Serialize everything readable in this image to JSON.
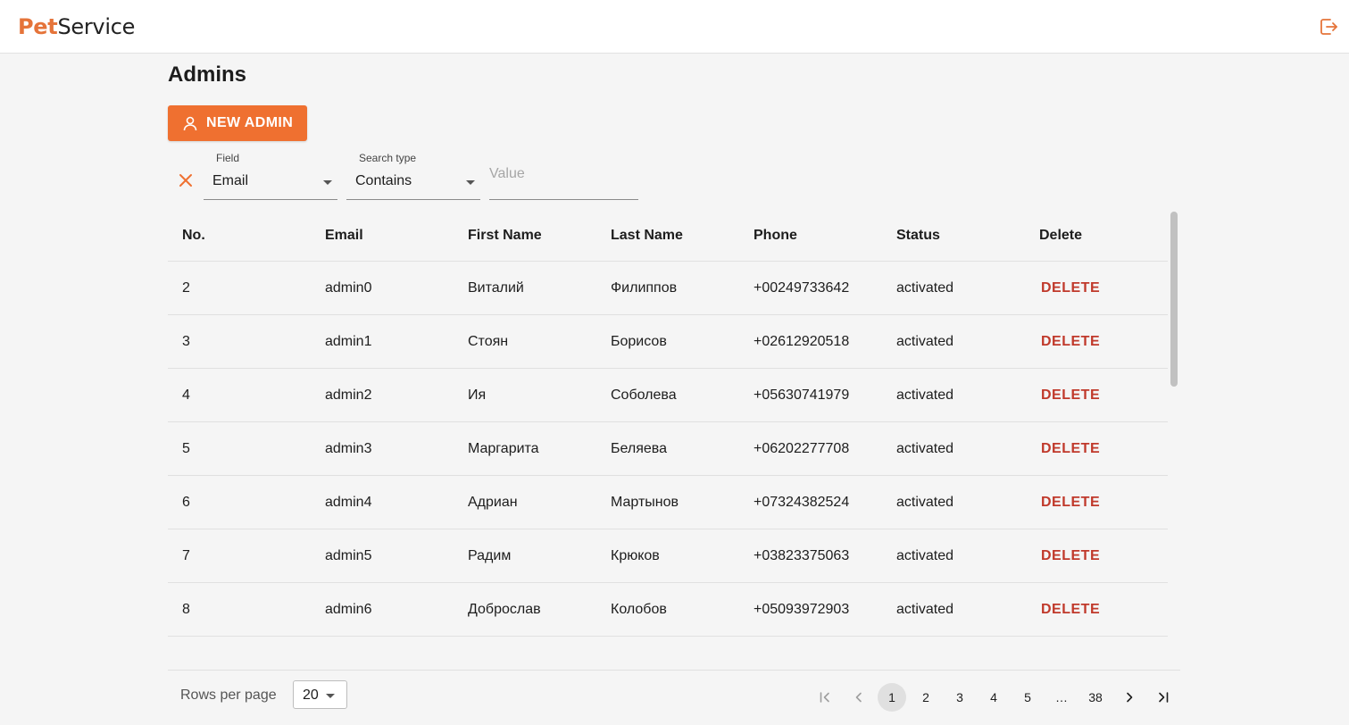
{
  "app": {
    "logo_pet": "Pet",
    "logo_service": "Service"
  },
  "page": {
    "title": "Admins"
  },
  "toolbar": {
    "new_admin_label": "NEW ADMIN"
  },
  "filter": {
    "field_caption": "Field",
    "field_value": "Email",
    "search_type_caption": "Search type",
    "search_type_value": "Contains",
    "value_placeholder": "Value"
  },
  "table": {
    "columns": [
      "No.",
      "Email",
      "First Name",
      "Last Name",
      "Phone",
      "Status",
      "Delete"
    ],
    "delete_label": "DELETE",
    "rows": [
      {
        "no": "2",
        "email": "admin0",
        "first": "Виталий",
        "last": "Филиппов",
        "phone": "+00249733642",
        "status": "activated"
      },
      {
        "no": "3",
        "email": "admin1",
        "first": "Стоян",
        "last": "Борисов",
        "phone": "+02612920518",
        "status": "activated"
      },
      {
        "no": "4",
        "email": "admin2",
        "first": "Ия",
        "last": "Соболева",
        "phone": "+05630741979",
        "status": "activated"
      },
      {
        "no": "5",
        "email": "admin3",
        "first": "Маргарита",
        "last": "Беляева",
        "phone": "+06202277708",
        "status": "activated"
      },
      {
        "no": "6",
        "email": "admin4",
        "first": "Адриан",
        "last": "Мартынов",
        "phone": "+07324382524",
        "status": "activated"
      },
      {
        "no": "7",
        "email": "admin5",
        "first": "Радим",
        "last": "Крюков",
        "phone": "+03823375063",
        "status": "activated"
      },
      {
        "no": "8",
        "email": "admin6",
        "first": "Доброслав",
        "last": "Колобов",
        "phone": "+05093972903",
        "status": "activated"
      }
    ]
  },
  "pagination": {
    "rows_per_page_label": "Rows per page",
    "rows_per_page_value": "20",
    "pages": [
      "1",
      "2",
      "3",
      "4",
      "5",
      "…",
      "38"
    ],
    "current_page": "1"
  },
  "icons": {
    "logout": "logout-icon",
    "new_admin": "user-icon",
    "clear": "close-icon",
    "first_page": "first-page-icon",
    "prev_page": "chevron-left-icon",
    "next_page": "chevron-right-icon",
    "last_page": "last-page-icon"
  },
  "colors": {
    "accent": "#ef7030",
    "danger": "#c0392b",
    "background": "#f5f5f5"
  }
}
